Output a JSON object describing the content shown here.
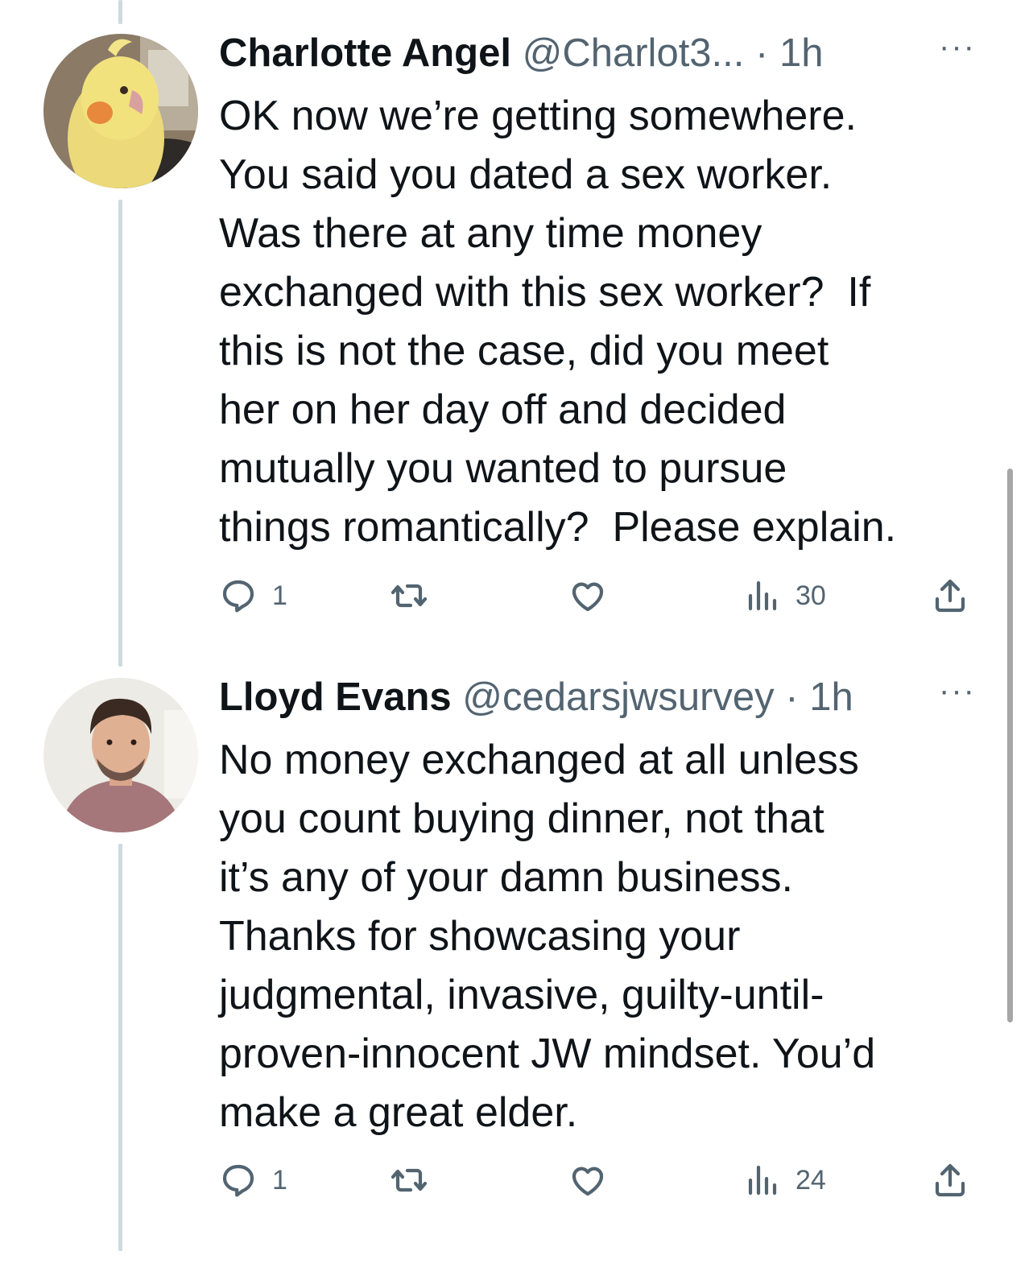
{
  "tweets": [
    {
      "name": "Charlotte Angel",
      "handle": "@Charlot3...",
      "separator": "·",
      "time": "1h",
      "more": "···",
      "text": "OK now we’re getting somewhere.\nYou said you dated a sex worker.\nWas there at any time money\nexchanged with this sex worker?  If\nthis is not the case, did you meet\nher on her day off and decided\nmutually you wanted to pursue\nthings romantically?  Please explain.",
      "replies": "1",
      "views": "30"
    },
    {
      "name": "Lloyd Evans",
      "handle": "@cedarsjwsurvey",
      "separator": "·",
      "time": "1h",
      "more": "···",
      "text": "No money exchanged at all unless\nyou count buying dinner, not that\nit’s any of your damn business.\nThanks for showcasing your\njudgmental, invasive, guilty-until-\nproven-innocent JW mindset. You’d\nmake a great elder.",
      "replies": "1",
      "views": "24"
    }
  ],
  "colors": {
    "text": "#0f1419",
    "secondary": "#536471",
    "thread_line": "#cfd9de"
  },
  "icons": [
    "reply-icon",
    "retweet-icon",
    "like-icon",
    "views-icon",
    "share-icon",
    "more-icon"
  ]
}
